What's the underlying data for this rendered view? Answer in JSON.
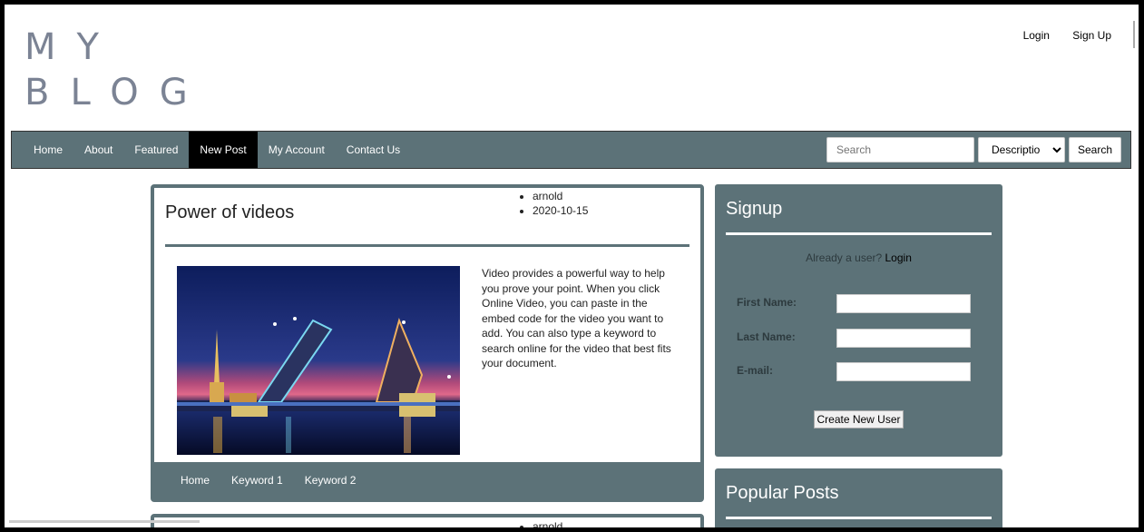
{
  "header": {
    "logo_line1": "MY",
    "logo_line2": "BLOG",
    "login": "Login",
    "signup": "Sign Up"
  },
  "nav": {
    "items": [
      "Home",
      "About",
      "Featured",
      "New Post",
      "My Account",
      "Contact Us"
    ],
    "active": "New Post",
    "search_placeholder": "Search",
    "filter_selected": "Description",
    "search_button": "Search"
  },
  "post": {
    "title": "Power of videos",
    "author": "arnold",
    "date": "2020-10-15",
    "body": "Video provides a powerful way to help you prove your point. When you click Online Video, you can paste in the embed code for the video you want to add. You can also type a keyword to search online for the video that best fits your document.",
    "footer_links": [
      "Home",
      "Keyword 1",
      "Keyword 2"
    ]
  },
  "post2": {
    "author": "arnold"
  },
  "signup": {
    "title": "Signup",
    "already_text": "Already a user?",
    "login_link": "Login",
    "first_name_label": "First Name:",
    "last_name_label": "Last Name:",
    "email_label": "E-mail:",
    "create_button": "Create New User"
  },
  "popular": {
    "title": "Popular Posts"
  },
  "colors": {
    "accent": "#5c7278",
    "active_nav": "#000000",
    "logo": "#7b8394"
  }
}
